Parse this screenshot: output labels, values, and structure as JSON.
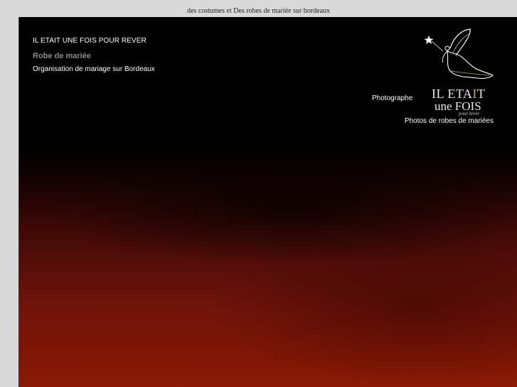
{
  "header": {
    "tagline": "des costumes et Des robes de mariée sur bordeaux"
  },
  "site": {
    "name": "IL ETAIT UNE FOIS POUR REVER",
    "subtitle": "Robe de mariée",
    "organisation_link": "Organisation de mariage sur Bordeaux"
  },
  "nav": {
    "photographe": "Photographe",
    "photos_robes": "Photos de robes de mariées"
  },
  "logo": {
    "line1_white": "IL ETA",
    "line1_gold": "I",
    "line1_end": "T",
    "line2": "une FOIS",
    "line3": "pour rever",
    "icon": "fairy-icon",
    "accent": "#c9a64a"
  },
  "colors": {
    "page_bg": "#d9d9d9",
    "frame_bg": "#000000",
    "gradient_red": "#8a1a06"
  }
}
